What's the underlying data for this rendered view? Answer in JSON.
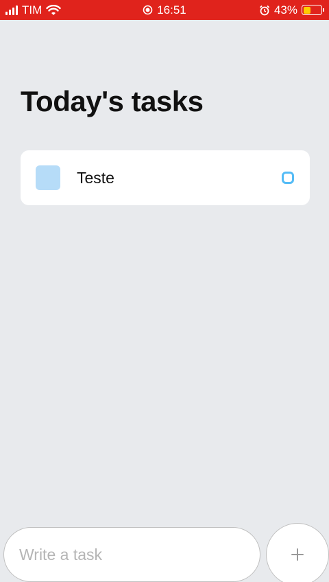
{
  "status_bar": {
    "carrier": "TIM",
    "time": "16:51",
    "battery_percent": "43%",
    "battery_level": 0.43,
    "icons": [
      "signal-icon",
      "wifi-icon",
      "recording-icon",
      "alarm-icon",
      "battery-icon"
    ]
  },
  "header": {
    "title": "Today's tasks"
  },
  "tasks": [
    {
      "text": "Teste"
    }
  ],
  "composer": {
    "placeholder": "Write a task",
    "value": "",
    "add_label": "+"
  },
  "colors": {
    "status_bar": "#e0231c",
    "background": "#e8eaed",
    "task_square": "#b6dcf8",
    "task_circle": "#55bcf6",
    "battery_fill": "#ffcc00"
  }
}
